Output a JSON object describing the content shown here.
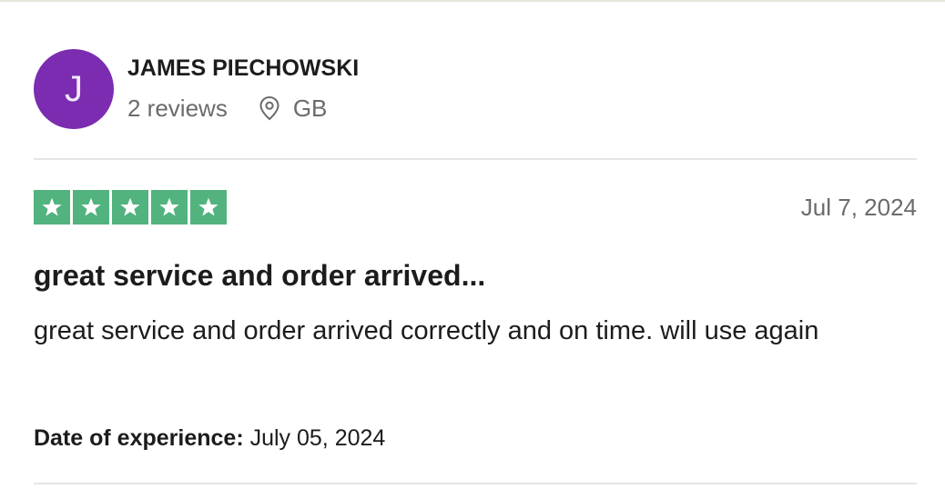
{
  "consumer": {
    "avatar_initial": "J",
    "avatar_color": "#7b2cb0",
    "name": "JAMES PIECHOWSKI",
    "reviews_count": "2 reviews",
    "location_icon": "location-pin-icon",
    "country": "GB"
  },
  "review": {
    "rating": 5,
    "rating_max": 5,
    "star_color": "#52b37f",
    "date": "Jul 7, 2024",
    "title": "great service and order arrived...",
    "text": "great service and order arrived correctly and on time. will use again",
    "experience_label": "Date of experience:",
    "experience_date": "July 05, 2024"
  }
}
